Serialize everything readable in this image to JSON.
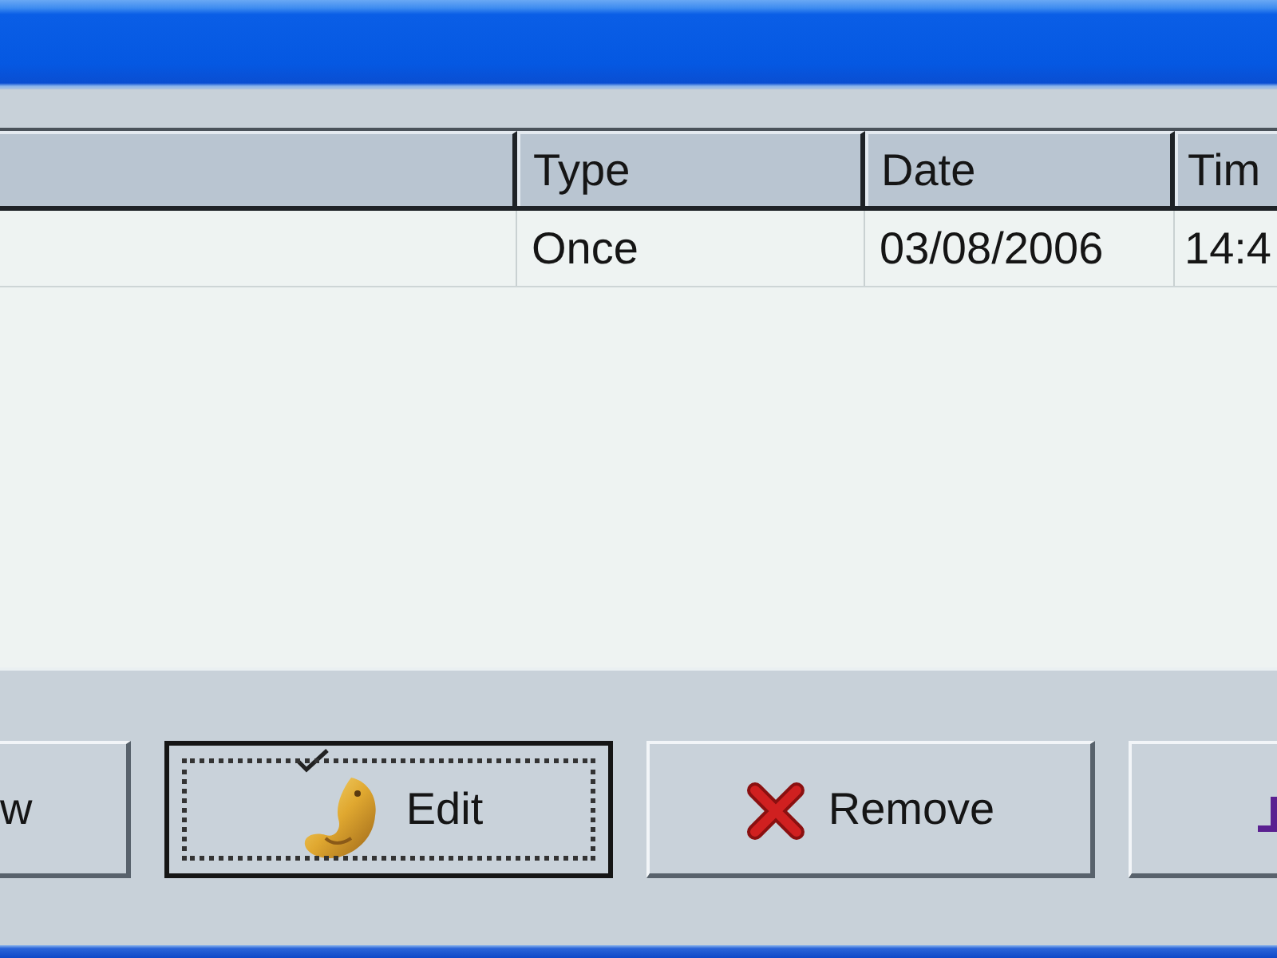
{
  "list": {
    "columns": [
      "Type",
      "Date",
      "Tim"
    ],
    "rows": [
      {
        "cells": [
          "Once",
          "03/08/2006",
          "14:4"
        ]
      }
    ]
  },
  "buttons": [
    {
      "label": "w",
      "kind": "plain",
      "focused": false
    },
    {
      "label": "Edit",
      "kind": "edit",
      "focused": true
    },
    {
      "label": "Remove",
      "kind": "remove",
      "focused": false
    },
    {
      "kind": "cutoff",
      "focused": false
    }
  ]
}
